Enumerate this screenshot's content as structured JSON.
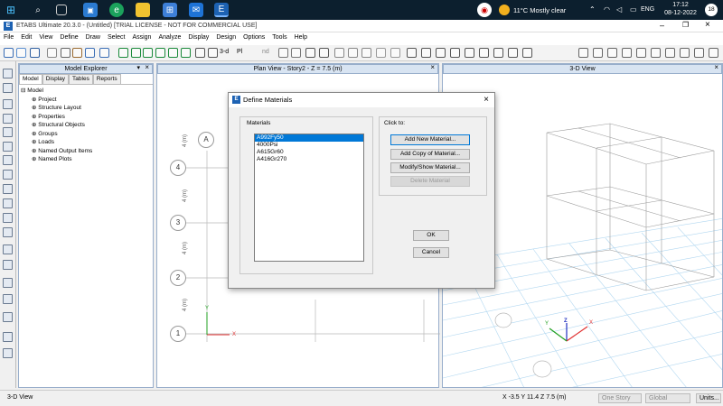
{
  "taskbar": {
    "weather": "11°C  Mostly clear",
    "lang": "ENG",
    "time": "17:12",
    "date": "08-12-2022",
    "badge": "18"
  },
  "app": {
    "title": "ETABS Ultimate 20.3.0 - (Untitled)  [TRIAL LICENSE - NOT FOR COMMERCIAL USE]"
  },
  "menu": [
    "File",
    "Edit",
    "View",
    "Define",
    "Draw",
    "Select",
    "Assign",
    "Analyze",
    "Display",
    "Design",
    "Options",
    "Tools",
    "Help"
  ],
  "toolbar": {
    "view_label": "3-d",
    "plan_label": "Pl",
    "elev_label": "nd"
  },
  "explorer": {
    "title": "Model Explorer",
    "tabs": [
      "Model",
      "Display",
      "Tables",
      "Reports"
    ],
    "root": "Model",
    "items": [
      "Project",
      "Structure Layout",
      "Properties",
      "Structural Objects",
      "Groups",
      "Loads",
      "Named Output Items",
      "Named Plots"
    ]
  },
  "plan": {
    "title": "Plan View - Story2 - Z = 7.5 (m)",
    "grid_col": "A",
    "grid_rows": [
      "4",
      "3",
      "2",
      "1"
    ],
    "dims": [
      "4 (m)",
      "4 (m)",
      "4 (m)",
      "4 (m)"
    ],
    "axis_x": "X",
    "axis_y": "Y"
  },
  "view3d": {
    "title": "3-D View",
    "axis_x": "X",
    "axis_y": "Y",
    "axis_z": "Z"
  },
  "dialog": {
    "title": "Define Materials",
    "materials_label": "Materials",
    "click_label": "Click to:",
    "materials": [
      "A992Fy50",
      "4000Psi",
      "A615Gr60",
      "A416Gr270"
    ],
    "buttons": {
      "add_new": "Add New Material...",
      "add_copy": "Add Copy of Material...",
      "modify": "Modify/Show Material...",
      "delete": "Delete Material",
      "ok": "OK",
      "cancel": "Cancel"
    }
  },
  "status": {
    "left": "3-D View",
    "coords": "X -3.5  Y 11.4  Z 7.5 (m)",
    "story": "One Story",
    "coord_sys": "Global",
    "units": "Units..."
  }
}
